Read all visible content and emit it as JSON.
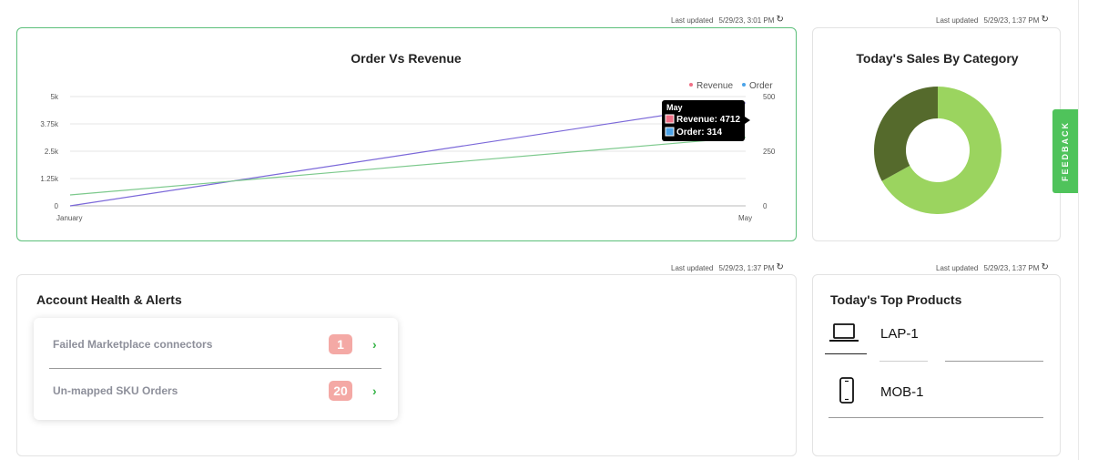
{
  "order_revenue": {
    "last_updated_label": "Last updated",
    "last_updated_value": "5/29/23, 3:01 PM",
    "title": "Order Vs Revenue",
    "legend": {
      "revenue": "Revenue",
      "order": "Order"
    },
    "left_axis_ticks": [
      "5k",
      "3.75k",
      "2.5k",
      "1.25k",
      "0"
    ],
    "right_axis_ticks": [
      "500",
      "250",
      "0"
    ],
    "x_ticks": [
      "January",
      "May"
    ],
    "tooltip": {
      "title": "May",
      "revenue": "Revenue: 4712",
      "order": "Order: 314"
    },
    "colors": {
      "revenue": "#7b68d9",
      "order": "#7cc98c",
      "tooltip_revenue": "#f06f86",
      "tooltip_order": "#4ba3e8"
    }
  },
  "chart_data": {
    "type": "line",
    "title": "Order Vs Revenue",
    "x": [
      "January",
      "May"
    ],
    "series": [
      {
        "name": "Revenue",
        "axis": "left",
        "values": [
          0,
          4712
        ]
      },
      {
        "name": "Order",
        "axis": "right",
        "values": [
          50,
          314
        ]
      }
    ],
    "ylim_left": [
      0,
      5000
    ],
    "ylim_right": [
      0,
      500
    ],
    "grid": true,
    "legend_position": "top-right"
  },
  "sales_category": {
    "last_updated_label": "Last updated",
    "last_updated_value": "5/29/23, 1:37 PM",
    "title": "Today's Sales By Category",
    "donut": {
      "slices": [
        0.67,
        0.33
      ],
      "colors": [
        "#9bd45f",
        "#556a2c"
      ]
    }
  },
  "account_health": {
    "last_updated_label": "Last updated",
    "last_updated_value": "5/29/23, 1:37 PM",
    "title": "Account Health & Alerts",
    "alerts": [
      {
        "label": "Failed Marketplace connectors",
        "count": "1"
      },
      {
        "label": "Un-mapped SKU Orders",
        "count": "20"
      }
    ]
  },
  "top_products": {
    "last_updated_label": "Last updated",
    "last_updated_value": "5/29/23, 1:37 PM",
    "title": "Today's Top Products",
    "items": [
      {
        "icon": "laptop-icon",
        "label": "LAP-1"
      },
      {
        "icon": "mobile-icon",
        "label": "MOB-1"
      }
    ]
  },
  "feedback_label": "FEEDBACK"
}
